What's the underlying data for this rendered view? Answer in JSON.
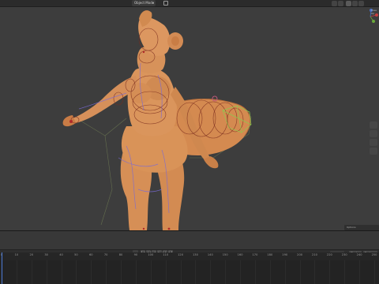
{
  "viewport": {
    "mode_label": "Object Mode",
    "header_tab": "Pose Op"
  },
  "timeline": {
    "frame_ticks": [
      "0",
      "10",
      "20",
      "30",
      "40",
      "50",
      "60",
      "70",
      "80",
      "90",
      "100",
      "110",
      "120",
      "130",
      "140",
      "150",
      "160",
      "170",
      "180",
      "190",
      "200",
      "210",
      "220",
      "230",
      "240",
      "250"
    ],
    "start_label": "Start",
    "end_label": "End",
    "playback_buttons": [
      "|◀",
      "◀◀",
      "◀",
      "▶",
      "▶▶",
      "▶|"
    ]
  },
  "mini_panel": {
    "label": "Options"
  },
  "colors": {
    "viewport_bg": "#3d3d3d",
    "skin": "#d9935a",
    "wire_dark": "#7a2c1e",
    "wire_purple": "#7a6ad6",
    "bone_green": "#8ec84f",
    "empty_circle": "#c0587a",
    "playhead": "#4d7bd6"
  }
}
